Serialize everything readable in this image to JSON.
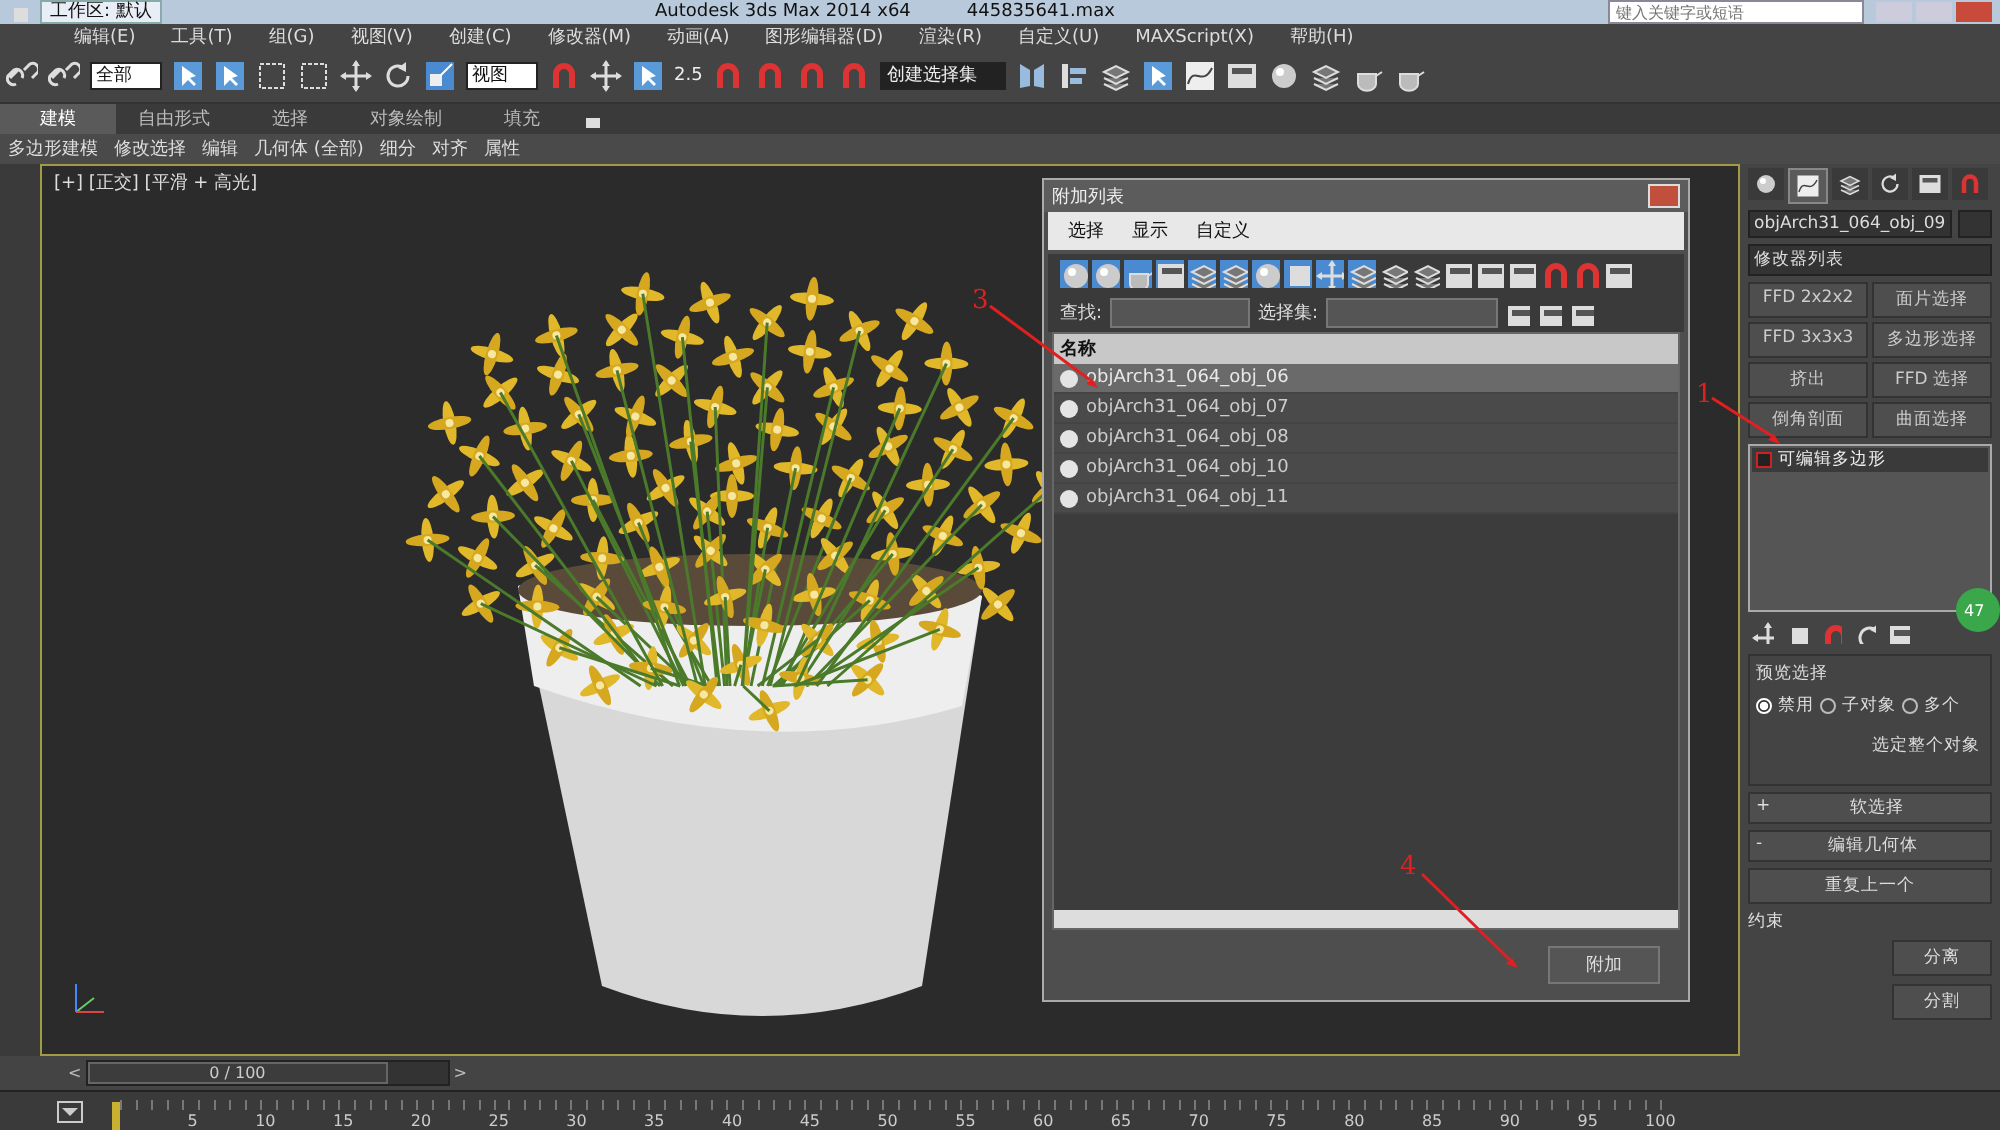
{
  "title_bar": {
    "workspace": "工作区: 默认",
    "title": "Autodesk 3ds Max  2014 x64",
    "file": "445835641.max",
    "search": {
      "placeholder": "键入关键字或短语"
    }
  },
  "menu_bar": [
    "编辑(E)",
    "工具(T)",
    "组(G)",
    "视图(V)",
    "创建(C)",
    "修改器(M)",
    "动画(A)",
    "图形编辑器(D)",
    "渲染(R)",
    "自定义(U)",
    "MAXScript(X)",
    "帮助(H)"
  ],
  "main_toolbar": {
    "selection_filter": "全部",
    "coord_system": "视图",
    "snap_label": "2.5",
    "selection_set": "创建选择集"
  },
  "ribbon": {
    "tabs": [
      {
        "label": "建模",
        "selected": true
      },
      {
        "label": "自由形式",
        "selected": false
      },
      {
        "label": "选择",
        "selected": false
      },
      {
        "label": "对象绘制",
        "selected": false
      },
      {
        "label": "填充",
        "selected": false
      }
    ],
    "panels": [
      "多边形建模",
      "修改选择",
      "编辑",
      "几何体 (全部)",
      "细分",
      "对齐",
      "属性"
    ]
  },
  "viewport": {
    "label": "[+] [正交] [平滑 + 高光]"
  },
  "attach_dialog": {
    "title": "附加列表",
    "menus": [
      "选择",
      "显示",
      "自定义"
    ],
    "find_label": "查找:",
    "selection_set_label": "选择集:",
    "column": "名称",
    "rows": [
      {
        "name": "objArch31_064_obj_06",
        "selected": true
      },
      {
        "name": "objArch31_064_obj_07",
        "selected": false
      },
      {
        "name": "objArch31_064_obj_08",
        "selected": false
      },
      {
        "name": "objArch31_064_obj_10",
        "selected": false
      },
      {
        "name": "objArch31_064_obj_11",
        "selected": false
      }
    ],
    "button": "附加"
  },
  "command_panel": {
    "tabs": [
      {
        "kind": "create",
        "selected": false
      },
      {
        "kind": "modify",
        "selected": true
      },
      {
        "kind": "hierarchy",
        "selected": false
      },
      {
        "kind": "motion",
        "selected": false
      },
      {
        "kind": "display",
        "selected": false
      },
      {
        "kind": "utilities",
        "selected": false
      }
    ],
    "object_name": "objArch31_064_obj_09",
    "modifier_list": "修改器列表",
    "modifier_buttons": [
      "FFD 2x2x2",
      "面片选择",
      "FFD 3x3x3",
      "多边形选择",
      "挤出",
      "FFD 选择",
      "倒角剖面",
      "曲面选择"
    ],
    "stack": [
      {
        "label": "可编辑多边形",
        "selected": true
      }
    ],
    "preview_selection": {
      "title": "预览选择",
      "options": [
        {
          "label": "禁用",
          "selected": true
        },
        {
          "label": "子对象",
          "selected": false
        },
        {
          "label": "多个",
          "selected": false
        }
      ],
      "note": "选定整个对象"
    },
    "rollouts": [
      {
        "sign": "+",
        "label": "软选择"
      },
      {
        "sign": "-",
        "label": "编辑几何体"
      }
    ],
    "repeat_last": "重复上一个",
    "constraints_title": "约束",
    "buttons": [
      "分离",
      "分割"
    ]
  },
  "badge": "47",
  "time_slider": {
    "prev": "<",
    "position": "0 / 100",
    "next": ">",
    "level": 0
  },
  "track_ticks": [
    "5",
    "10",
    "15",
    "20",
    "25",
    "30",
    "35",
    "40",
    "45",
    "50",
    "55",
    "60",
    "65",
    "70",
    "75",
    "80",
    "85",
    "90",
    "95",
    "100"
  ],
  "annotations": [
    {
      "label": "1"
    },
    {
      "label": "3"
    },
    {
      "label": "4"
    }
  ]
}
